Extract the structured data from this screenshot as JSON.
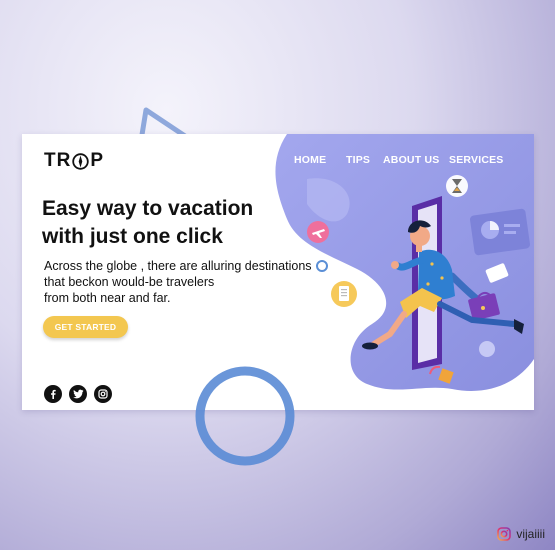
{
  "brand": {
    "logo_text_left": "TR",
    "logo_text_right": "P"
  },
  "nav": {
    "items": [
      {
        "label": "HOME"
      },
      {
        "label": "TIPS"
      },
      {
        "label": "ABOUT US"
      },
      {
        "label": "SERVICES"
      }
    ]
  },
  "hero": {
    "headline_line1": "Easy way to vacation",
    "headline_line2": "with just one click",
    "description_lines": [
      "Across the globe , there are alluring destinations",
      "that beckon would-be travelers",
      "from both near and far."
    ],
    "cta_label": "GET STARTED"
  },
  "social": {
    "icons": [
      "facebook-icon",
      "twitter-icon",
      "instagram-icon"
    ]
  },
  "credit": {
    "handle": "vijaiiii",
    "icon": "instagram-icon"
  },
  "colors": {
    "accent_blob": "#8f95e3",
    "cta": "#f3c750",
    "heading": "#111111",
    "door": "#5a2ea6",
    "ring": "#5b8fd6"
  }
}
